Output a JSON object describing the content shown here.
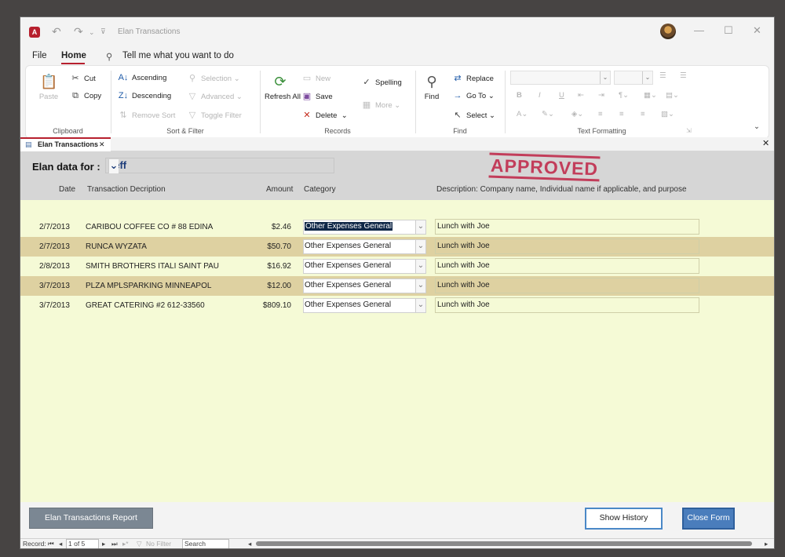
{
  "window": {
    "title": "Elan Transactions"
  },
  "menu": {
    "file": "File",
    "home": "Home",
    "tell_me": "Tell me what you want to do"
  },
  "ribbon": {
    "clipboard": {
      "label": "Clipboard",
      "paste": "Paste",
      "cut": "Cut",
      "copy": "Copy"
    },
    "sort_filter": {
      "label": "Sort & Filter",
      "ascending": "Ascending",
      "descending": "Descending",
      "remove_sort": "Remove Sort",
      "selection": "Selection",
      "advanced": "Advanced",
      "toggle_filter": "Toggle Filter"
    },
    "records": {
      "label": "Records",
      "refresh_all": "Refresh All",
      "new": "New",
      "save": "Save",
      "delete": "Delete",
      "spelling": "Spelling",
      "more": "More"
    },
    "find": {
      "label": "Find",
      "find": "Find",
      "replace": "Replace",
      "go_to": "Go To",
      "select": "Select"
    },
    "text_formatting": {
      "label": "Text Formatting"
    }
  },
  "doc_tab": {
    "label": "Elan Transactions"
  },
  "form": {
    "data_for_label": "Elan data for :",
    "user": "Jeff",
    "stamp": "APPROVED",
    "columns": {
      "date": "Date",
      "transaction": "Transaction Decription",
      "amount": "Amount",
      "category": "Category",
      "description": "Description: Company name, Individual name if applicable, and purpose"
    },
    "rows": [
      {
        "date": "2/7/2013",
        "transaction": "CARIBOU COFFEE CO # 88 EDINA",
        "amount": "$2.46",
        "category": "Other Expenses General",
        "description": "Lunch with Joe"
      },
      {
        "date": "2/7/2013",
        "transaction": "RUNCA WYZATA",
        "amount": "$50.70",
        "category": "Other Expenses General",
        "description": "Lunch with Joe"
      },
      {
        "date": "2/8/2013",
        "transaction": "SMITH BROTHERS ITALI SAINT PAU",
        "amount": "$16.92",
        "category": "Other Expenses General",
        "description": "Lunch with Joe"
      },
      {
        "date": "3/7/2013",
        "transaction": "PLZA MPLSPARKING MINNEAPOL",
        "amount": "$12.00",
        "category": "Other Expenses General",
        "description": "Lunch with Joe"
      },
      {
        "date": "3/7/2013",
        "transaction": "GREAT CATERING #2 612-33560",
        "amount": "$809.10",
        "category": "Other Expenses General",
        "description": "Lunch with Joe"
      }
    ],
    "buttons": {
      "report": "Elan Transactions Report",
      "history": "Show History",
      "close": "Close Form"
    }
  },
  "navbar": {
    "record": "Record:",
    "position": "1 of 5",
    "no_filter": "No Filter",
    "search": "Search"
  },
  "colors": {
    "accent": "#b7202e",
    "form_bg": "#f5fad6",
    "alt_row": "#ded1a1",
    "header_bg": "#d6d6d6",
    "stamp": "#c0284a"
  }
}
